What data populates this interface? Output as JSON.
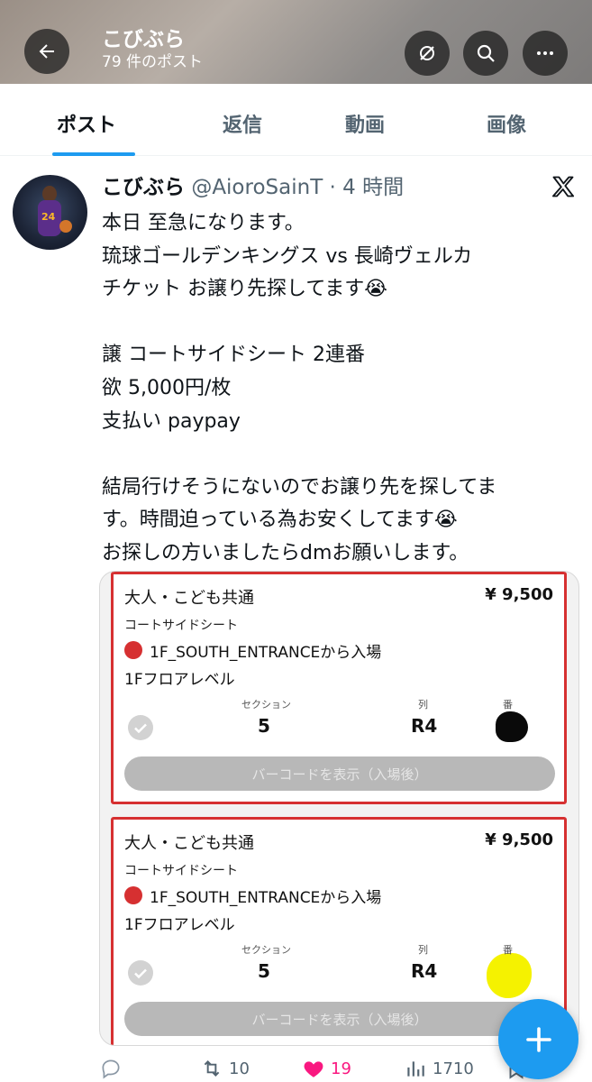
{
  "header": {
    "name": "こびぶら",
    "post_count": "79 件のポスト"
  },
  "tabs": [
    {
      "label": "ポスト",
      "active": true
    },
    {
      "label": "返信",
      "active": false
    },
    {
      "label": "動画",
      "active": false
    },
    {
      "label": "画像",
      "active": false
    }
  ],
  "post": {
    "display_name": "こびぶら",
    "handle_time": "@AioroSainT · 4 時間",
    "text": "本日 至急になります。\n琉球ゴールデンキングス vs 長崎ヴェルカ\nチケット お譲り先探してます😭\n\n譲 コートサイドシート 2連番\n欲 5,000円/枚\n支払い paypay\n\n結局行けそうにないのでお譲り先を探してま\nす。時間迫っている為お安くしてます😭\nお探しの方いましたらdmお願いします。"
  },
  "tickets": [
    {
      "type": "大人・こども共通",
      "price": "¥ 9,500",
      "seat_type": "コートサイドシート",
      "entrance": "1F_SOUTH_ENTRANCEから入場",
      "level": "1Fフロアレベル",
      "section_label": "セクション",
      "section": "5",
      "row_label": "列",
      "row": "R4",
      "number_label": "番",
      "barcode_label": "バーコードを表示（入場後）"
    },
    {
      "type": "大人・こども共通",
      "price": "¥ 9,500",
      "seat_type": "コートサイドシート",
      "entrance": "1F_SOUTH_ENTRANCEから入場",
      "level": "1Fフロアレベル",
      "section_label": "セクション",
      "section": "5",
      "row_label": "列",
      "row": "R4",
      "number_label": "番",
      "barcode_label": "バーコードを表示（入場後）"
    }
  ],
  "actions": {
    "retweets": "10",
    "likes": "19",
    "views": "1710"
  },
  "colors": {
    "accent": "#1d9bf0",
    "like": "#f91880",
    "ticket_border": "#d63031"
  },
  "icons": [
    "back-arrow-icon",
    "hide-icon",
    "search-icon",
    "more-icon",
    "x-logo-icon",
    "check-icon",
    "reply-icon",
    "retweet-icon",
    "heart-icon",
    "views-icon",
    "bookmark-icon",
    "plus-icon"
  ]
}
